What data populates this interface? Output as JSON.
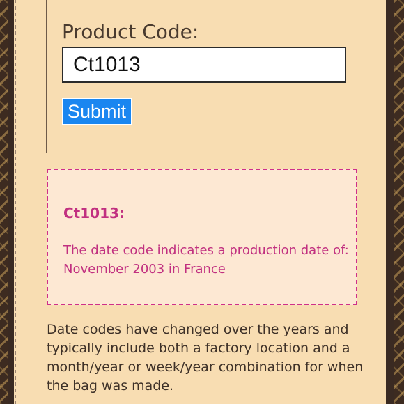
{
  "form": {
    "label": "Product Code:",
    "input_value": "Ct1013",
    "submit_label": "Submit"
  },
  "result": {
    "code_heading": "Ct1013:",
    "message": "The date code indicates a production date of: November 2003 in France"
  },
  "info": {
    "text": "Date codes have changed over the years and typically include both a factory location and a month/year or week/year combination for when the bag was made."
  },
  "colors": {
    "page_background": "#f8ddb2",
    "accent_pink": "#c13080",
    "button_blue": "#1a86f0",
    "border_brown": "#3d2b20"
  }
}
